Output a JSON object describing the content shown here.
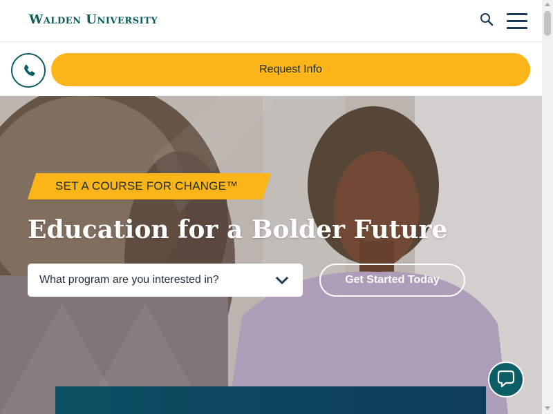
{
  "header": {
    "logo_text": "Walden University",
    "search_icon": "search-icon",
    "menu_icon": "hamburger-menu-icon"
  },
  "request_bar": {
    "phone_icon": "phone-icon",
    "request_label": "Request Info"
  },
  "hero": {
    "tagline": "SET A COURSE FOR CHANGE™",
    "headline": "Education for a Bolder Future",
    "program_placeholder": "What program are you interested in?",
    "chevron_icon": "chevron-down-icon",
    "cta_label": "Get Started Today"
  },
  "chat": {
    "icon": "chat-bubble-icon"
  },
  "colors": {
    "brand_teal": "#0b5e5a",
    "accent_yellow": "#fbb519",
    "navy": "#1a3a57"
  }
}
